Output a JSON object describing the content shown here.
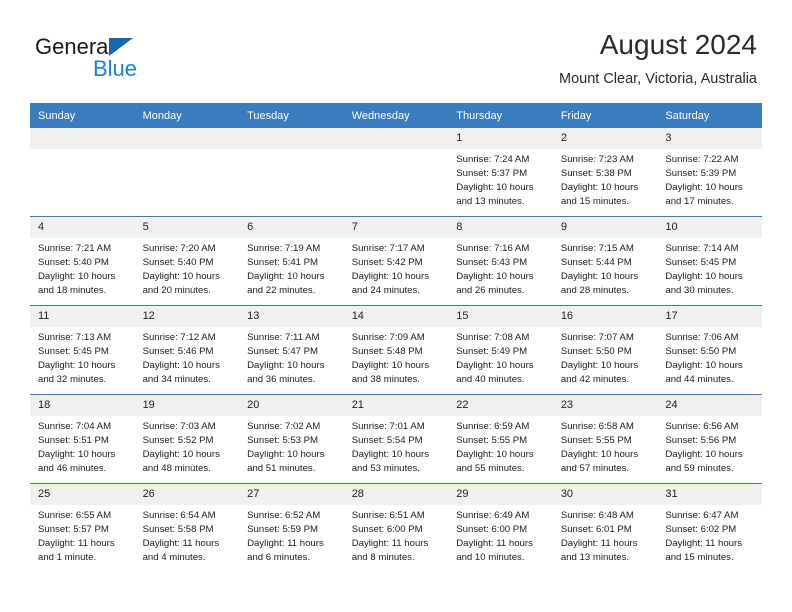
{
  "brand": {
    "name_part1": "General",
    "name_part2": "Blue",
    "logo_icon": "triangle-icon"
  },
  "header": {
    "month_title": "August 2024",
    "location": "Mount Clear, Victoria, Australia"
  },
  "colors": {
    "header_blue": "#3a7dbf",
    "brand_blue": "#1d7fd4",
    "daynum_bg": "#f0f0f0"
  },
  "calendar": {
    "weekday_headers": [
      "Sunday",
      "Monday",
      "Tuesday",
      "Wednesday",
      "Thursday",
      "Friday",
      "Saturday"
    ],
    "weeks": [
      [
        {
          "day": "",
          "empty": true,
          "sunrise": "",
          "sunset": "",
          "daylight1": "",
          "daylight2": ""
        },
        {
          "day": "",
          "empty": true,
          "sunrise": "",
          "sunset": "",
          "daylight1": "",
          "daylight2": ""
        },
        {
          "day": "",
          "empty": true,
          "sunrise": "",
          "sunset": "",
          "daylight1": "",
          "daylight2": ""
        },
        {
          "day": "",
          "empty": true,
          "sunrise": "",
          "sunset": "",
          "daylight1": "",
          "daylight2": ""
        },
        {
          "day": "1",
          "empty": false,
          "sunrise": "Sunrise: 7:24 AM",
          "sunset": "Sunset: 5:37 PM",
          "daylight1": "Daylight: 10 hours",
          "daylight2": "and 13 minutes."
        },
        {
          "day": "2",
          "empty": false,
          "sunrise": "Sunrise: 7:23 AM",
          "sunset": "Sunset: 5:38 PM",
          "daylight1": "Daylight: 10 hours",
          "daylight2": "and 15 minutes."
        },
        {
          "day": "3",
          "empty": false,
          "sunrise": "Sunrise: 7:22 AM",
          "sunset": "Sunset: 5:39 PM",
          "daylight1": "Daylight: 10 hours",
          "daylight2": "and 17 minutes."
        }
      ],
      [
        {
          "day": "4",
          "empty": false,
          "sunrise": "Sunrise: 7:21 AM",
          "sunset": "Sunset: 5:40 PM",
          "daylight1": "Daylight: 10 hours",
          "daylight2": "and 18 minutes."
        },
        {
          "day": "5",
          "empty": false,
          "sunrise": "Sunrise: 7:20 AM",
          "sunset": "Sunset: 5:40 PM",
          "daylight1": "Daylight: 10 hours",
          "daylight2": "and 20 minutes."
        },
        {
          "day": "6",
          "empty": false,
          "sunrise": "Sunrise: 7:19 AM",
          "sunset": "Sunset: 5:41 PM",
          "daylight1": "Daylight: 10 hours",
          "daylight2": "and 22 minutes."
        },
        {
          "day": "7",
          "empty": false,
          "sunrise": "Sunrise: 7:17 AM",
          "sunset": "Sunset: 5:42 PM",
          "daylight1": "Daylight: 10 hours",
          "daylight2": "and 24 minutes."
        },
        {
          "day": "8",
          "empty": false,
          "sunrise": "Sunrise: 7:16 AM",
          "sunset": "Sunset: 5:43 PM",
          "daylight1": "Daylight: 10 hours",
          "daylight2": "and 26 minutes."
        },
        {
          "day": "9",
          "empty": false,
          "sunrise": "Sunrise: 7:15 AM",
          "sunset": "Sunset: 5:44 PM",
          "daylight1": "Daylight: 10 hours",
          "daylight2": "and 28 minutes."
        },
        {
          "day": "10",
          "empty": false,
          "sunrise": "Sunrise: 7:14 AM",
          "sunset": "Sunset: 5:45 PM",
          "daylight1": "Daylight: 10 hours",
          "daylight2": "and 30 minutes."
        }
      ],
      [
        {
          "day": "11",
          "empty": false,
          "sunrise": "Sunrise: 7:13 AM",
          "sunset": "Sunset: 5:45 PM",
          "daylight1": "Daylight: 10 hours",
          "daylight2": "and 32 minutes."
        },
        {
          "day": "12",
          "empty": false,
          "sunrise": "Sunrise: 7:12 AM",
          "sunset": "Sunset: 5:46 PM",
          "daylight1": "Daylight: 10 hours",
          "daylight2": "and 34 minutes."
        },
        {
          "day": "13",
          "empty": false,
          "sunrise": "Sunrise: 7:11 AM",
          "sunset": "Sunset: 5:47 PM",
          "daylight1": "Daylight: 10 hours",
          "daylight2": "and 36 minutes."
        },
        {
          "day": "14",
          "empty": false,
          "sunrise": "Sunrise: 7:09 AM",
          "sunset": "Sunset: 5:48 PM",
          "daylight1": "Daylight: 10 hours",
          "daylight2": "and 38 minutes."
        },
        {
          "day": "15",
          "empty": false,
          "sunrise": "Sunrise: 7:08 AM",
          "sunset": "Sunset: 5:49 PM",
          "daylight1": "Daylight: 10 hours",
          "daylight2": "and 40 minutes."
        },
        {
          "day": "16",
          "empty": false,
          "sunrise": "Sunrise: 7:07 AM",
          "sunset": "Sunset: 5:50 PM",
          "daylight1": "Daylight: 10 hours",
          "daylight2": "and 42 minutes."
        },
        {
          "day": "17",
          "empty": false,
          "sunrise": "Sunrise: 7:06 AM",
          "sunset": "Sunset: 5:50 PM",
          "daylight1": "Daylight: 10 hours",
          "daylight2": "and 44 minutes."
        }
      ],
      [
        {
          "day": "18",
          "empty": false,
          "sunrise": "Sunrise: 7:04 AM",
          "sunset": "Sunset: 5:51 PM",
          "daylight1": "Daylight: 10 hours",
          "daylight2": "and 46 minutes."
        },
        {
          "day": "19",
          "empty": false,
          "sunrise": "Sunrise: 7:03 AM",
          "sunset": "Sunset: 5:52 PM",
          "daylight1": "Daylight: 10 hours",
          "daylight2": "and 48 minutes."
        },
        {
          "day": "20",
          "empty": false,
          "sunrise": "Sunrise: 7:02 AM",
          "sunset": "Sunset: 5:53 PM",
          "daylight1": "Daylight: 10 hours",
          "daylight2": "and 51 minutes."
        },
        {
          "day": "21",
          "empty": false,
          "sunrise": "Sunrise: 7:01 AM",
          "sunset": "Sunset: 5:54 PM",
          "daylight1": "Daylight: 10 hours",
          "daylight2": "and 53 minutes."
        },
        {
          "day": "22",
          "empty": false,
          "sunrise": "Sunrise: 6:59 AM",
          "sunset": "Sunset: 5:55 PM",
          "daylight1": "Daylight: 10 hours",
          "daylight2": "and 55 minutes."
        },
        {
          "day": "23",
          "empty": false,
          "sunrise": "Sunrise: 6:58 AM",
          "sunset": "Sunset: 5:55 PM",
          "daylight1": "Daylight: 10 hours",
          "daylight2": "and 57 minutes."
        },
        {
          "day": "24",
          "empty": false,
          "sunrise": "Sunrise: 6:56 AM",
          "sunset": "Sunset: 5:56 PM",
          "daylight1": "Daylight: 10 hours",
          "daylight2": "and 59 minutes."
        }
      ],
      [
        {
          "day": "25",
          "empty": false,
          "sunrise": "Sunrise: 6:55 AM",
          "sunset": "Sunset: 5:57 PM",
          "daylight1": "Daylight: 11 hours",
          "daylight2": "and 1 minute."
        },
        {
          "day": "26",
          "empty": false,
          "sunrise": "Sunrise: 6:54 AM",
          "sunset": "Sunset: 5:58 PM",
          "daylight1": "Daylight: 11 hours",
          "daylight2": "and 4 minutes."
        },
        {
          "day": "27",
          "empty": false,
          "sunrise": "Sunrise: 6:52 AM",
          "sunset": "Sunset: 5:59 PM",
          "daylight1": "Daylight: 11 hours",
          "daylight2": "and 6 minutes."
        },
        {
          "day": "28",
          "empty": false,
          "sunrise": "Sunrise: 6:51 AM",
          "sunset": "Sunset: 6:00 PM",
          "daylight1": "Daylight: 11 hours",
          "daylight2": "and 8 minutes."
        },
        {
          "day": "29",
          "empty": false,
          "sunrise": "Sunrise: 6:49 AM",
          "sunset": "Sunset: 6:00 PM",
          "daylight1": "Daylight: 11 hours",
          "daylight2": "and 10 minutes."
        },
        {
          "day": "30",
          "empty": false,
          "sunrise": "Sunrise: 6:48 AM",
          "sunset": "Sunset: 6:01 PM",
          "daylight1": "Daylight: 11 hours",
          "daylight2": "and 13 minutes."
        },
        {
          "day": "31",
          "empty": false,
          "sunrise": "Sunrise: 6:47 AM",
          "sunset": "Sunset: 6:02 PM",
          "daylight1": "Daylight: 11 hours",
          "daylight2": "and 15 minutes."
        }
      ]
    ]
  }
}
